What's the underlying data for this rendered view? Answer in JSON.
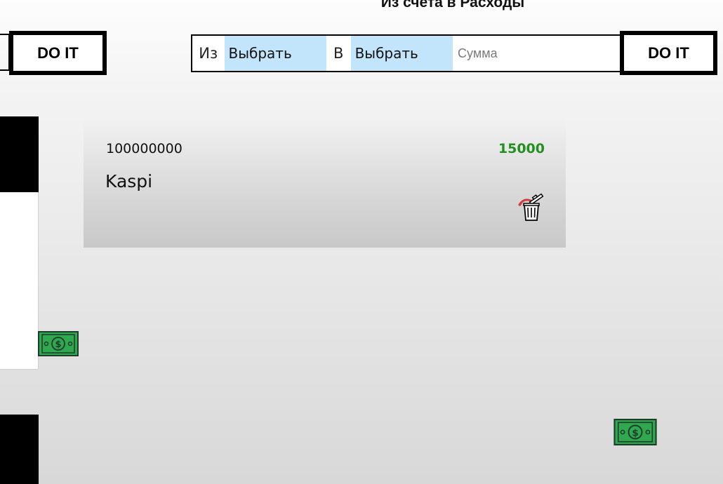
{
  "header": {
    "title": "Из счета в Расходы"
  },
  "actions": {
    "do_it_left_label": "DO IT",
    "do_it_right_label": "DO IT"
  },
  "transfer_form": {
    "from_label": "Из",
    "from_select_value": "Выбрать",
    "to_label": "В",
    "to_select_value": "Выбрать",
    "amount_placeholder": "Сумма",
    "amount_value": ""
  },
  "account_card": {
    "number": "100000000",
    "balance": "15000",
    "name": "Kaspi",
    "balance_color": "#22901f"
  },
  "icons": {
    "delete": "trash-icon",
    "money": "money-bill-icon"
  },
  "colors": {
    "select_background": "#c3e5fb",
    "money_green": "#2fa84f"
  }
}
